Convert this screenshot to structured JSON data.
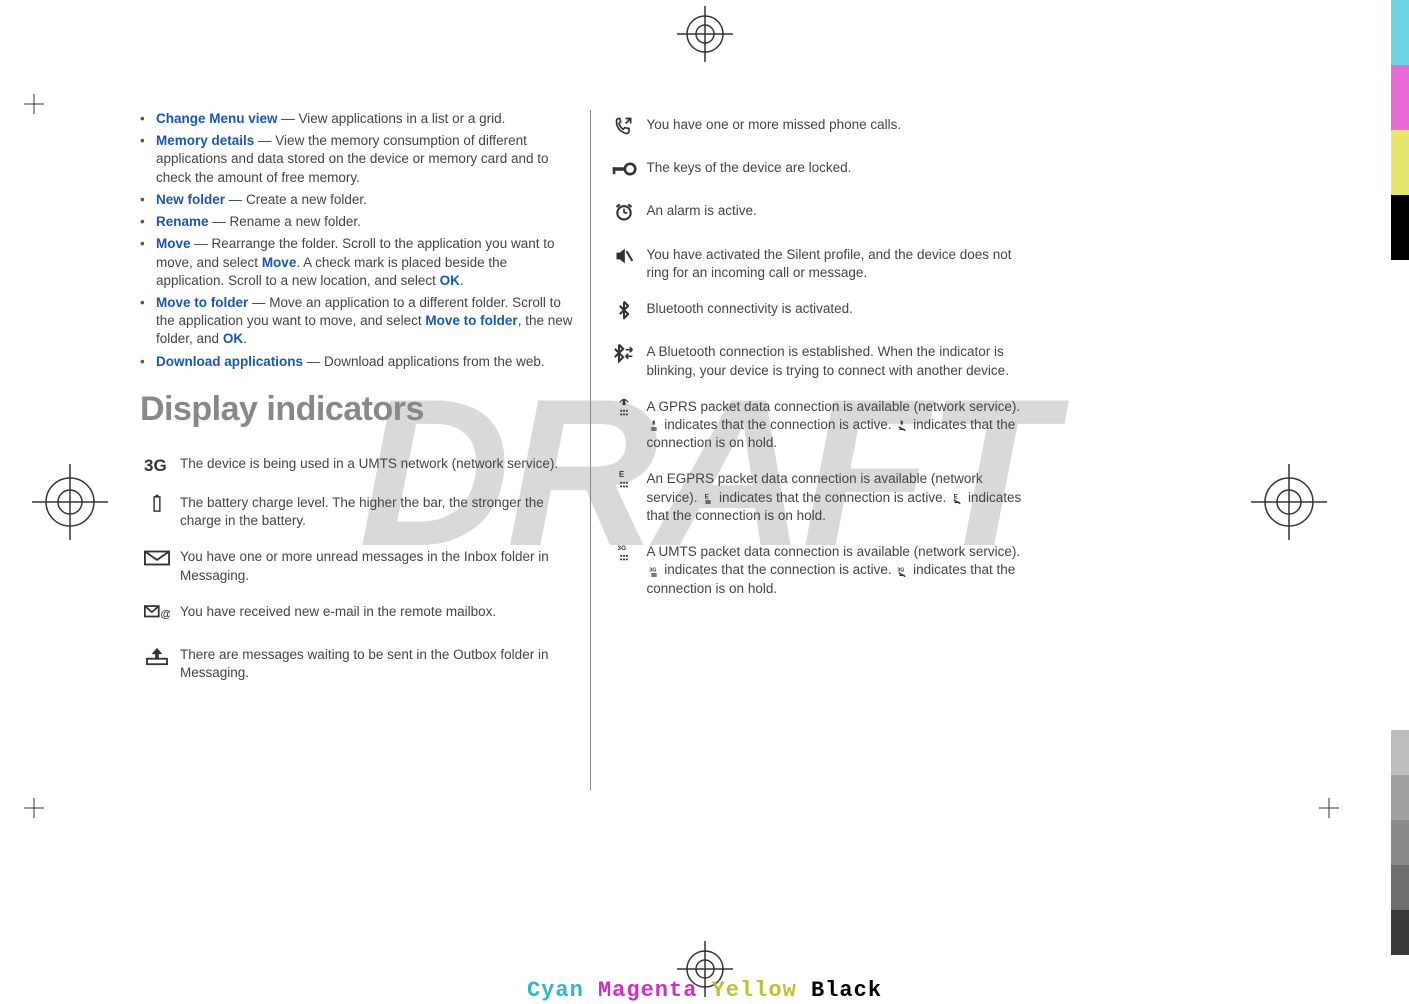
{
  "watermark": "DRAFT",
  "footer_colors": {
    "cyan": "Cyan",
    "magenta": "Magenta",
    "yellow": "Yellow",
    "black": "Black"
  },
  "left": {
    "menu": [
      {
        "link": "Change Menu view",
        "body": " — View applications in a list or a grid."
      },
      {
        "link": "Memory details",
        "body": " — View the memory consumption of different applications and data stored on the device or memory card and to check the amount of free memory."
      },
      {
        "link": "New folder",
        "body": " — Create a new folder."
      },
      {
        "link": "Rename",
        "body": " — Rename a new folder."
      },
      {
        "link": "Move",
        "body_pre": " — Rearrange the folder. Scroll to the application you want to move, and select ",
        "link2": "Move",
        "body_mid": ". A check mark is placed beside the application. Scroll to a new location, and select ",
        "link3": "OK",
        "body_post": "."
      },
      {
        "link": "Move to folder",
        "body_pre": " — Move an application to a different folder. Scroll to the application you want to move, and select ",
        "link2": "Move to folder",
        "body_mid": ", the new folder, and ",
        "link3": "OK",
        "body_post": "."
      },
      {
        "link": "Download applications",
        "body": " — Download applications from the web."
      }
    ],
    "section_title": "Display indicators",
    "rows": [
      {
        "icon": "3g",
        "text": "The device is being used in a UMTS network (network service)."
      },
      {
        "icon": "battery",
        "text": "The battery charge level. The higher the bar, the stronger the charge in the battery."
      },
      {
        "icon": "envelope",
        "text": "You have one or more unread messages in the Inbox folder in Messaging."
      },
      {
        "icon": "email-at",
        "text": "You have received new e-mail in the remote mailbox."
      },
      {
        "icon": "outbox",
        "text": "There are messages waiting to be sent in the Outbox folder in Messaging."
      }
    ]
  },
  "right": {
    "rows": [
      {
        "icon": "missed-call",
        "text": "You have one or more missed phone calls."
      },
      {
        "icon": "key-lock",
        "text": "The keys of the device are locked."
      },
      {
        "icon": "alarm",
        "text": "An alarm is active."
      },
      {
        "icon": "silent",
        "text": "You have activated the Silent profile, and the device does not ring for an incoming call or message."
      },
      {
        "icon": "bluetooth",
        "text": "Bluetooth connectivity is activated."
      },
      {
        "icon": "bt-conn",
        "text": "A Bluetooth connection is established. When the indicator is blinking, your device is trying to connect with another device."
      },
      {
        "icon": "gprs",
        "text_pre": "A GPRS packet data connection is available (network service). ",
        "inline1": "gprs-active",
        "text_mid": " indicates that the connection is active. ",
        "inline2": "gprs-hold",
        "text_post": " indicates that the connection is on hold."
      },
      {
        "icon": "egprs",
        "text_pre": "An EGPRS packet data connection is available (network service). ",
        "inline1": "egprs-active",
        "text_mid": " indicates that the connection is active. ",
        "inline2": "egprs-hold",
        "text_post": " indicates that the connection is on hold."
      },
      {
        "icon": "umts",
        "text_pre": "A UMTS packet data connection is available (network service). ",
        "inline1": "umts-active",
        "text_mid": " indicates that the connection is active. ",
        "inline2": "umts-hold",
        "text_post": " indicates that the connection is on hold."
      }
    ]
  }
}
